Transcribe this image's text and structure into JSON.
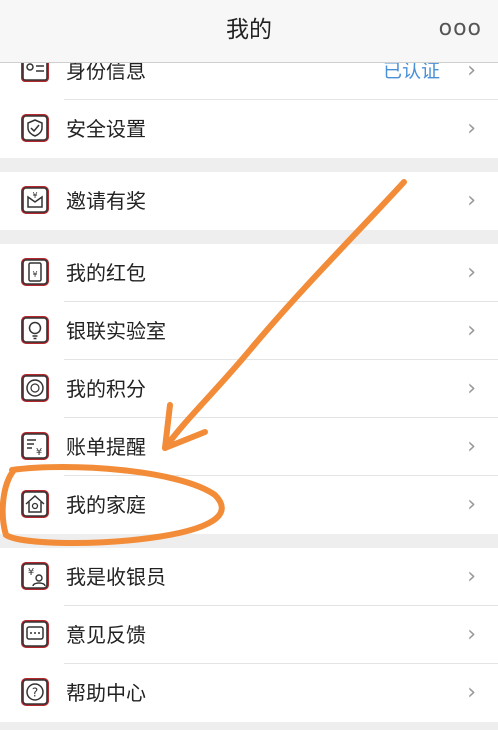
{
  "header": {
    "title": "我的",
    "more_icon": "ooo"
  },
  "rows": [
    {
      "label": "身份信息",
      "value": "已认证",
      "icon": "id-card-icon"
    },
    {
      "label": "安全设置",
      "icon": "shield-icon"
    },
    {
      "label": "邀请有奖",
      "icon": "gift-icon"
    },
    {
      "label": "我的红包",
      "icon": "red-packet-icon"
    },
    {
      "label": "银联实验室",
      "icon": "lightbulb-icon"
    },
    {
      "label": "我的积分",
      "icon": "points-icon"
    },
    {
      "label": "账单提醒",
      "icon": "bill-icon"
    },
    {
      "label": "我的家庭",
      "icon": "home-icon"
    },
    {
      "label": "我是收银员",
      "icon": "cashier-icon"
    },
    {
      "label": "意见反馈",
      "icon": "feedback-icon"
    },
    {
      "label": "帮助中心",
      "icon": "help-icon"
    }
  ],
  "chevron": "›",
  "colors": {
    "accent_red": "#b5282e",
    "value_blue": "#4a90d9",
    "annotation_orange": "#f28c38"
  }
}
